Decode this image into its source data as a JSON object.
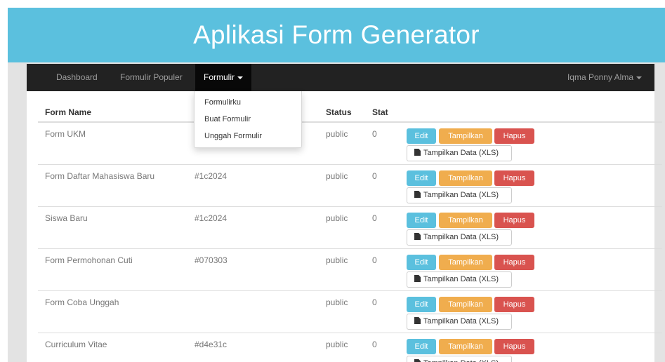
{
  "header": {
    "title": "Aplikasi Form Generator"
  },
  "navbar": {
    "items": [
      {
        "label": "Dashboard"
      },
      {
        "label": "Formulir Populer"
      },
      {
        "label": "Formulir"
      }
    ],
    "user": "Iqma Ponny Alma"
  },
  "dropdown": {
    "items": [
      {
        "label": "Formulirku"
      },
      {
        "label": "Buat Formulir"
      },
      {
        "label": "Unggah Formulir"
      }
    ]
  },
  "table": {
    "headers": {
      "name": "Form Name",
      "status": "Status",
      "stat": "Stat"
    },
    "rows": [
      {
        "name": "Form UKM",
        "color": "",
        "status": "public",
        "stat": "0"
      },
      {
        "name": "Form Daftar Mahasiswa Baru",
        "color": "#1c2024",
        "status": "public",
        "stat": "0"
      },
      {
        "name": "Siswa Baru",
        "color": "#1c2024",
        "status": "public",
        "stat": "0"
      },
      {
        "name": "Form Permohonan Cuti",
        "color": "#070303",
        "status": "public",
        "stat": "0"
      },
      {
        "name": "Form Coba Unggah",
        "color": "",
        "status": "public",
        "stat": "0"
      },
      {
        "name": "Curriculum Vitae",
        "color": "#d4e31c",
        "status": "public",
        "stat": "0"
      }
    ],
    "actions": {
      "edit": "Edit",
      "show": "Tampilkan",
      "delete": "Hapus",
      "xls": "Tampilkan Data (XLS)"
    }
  },
  "colors": {
    "header_bg": "#5bc0de",
    "navbar_bg": "#222222",
    "btn_info": "#5bc0de",
    "btn_warning": "#f0ad4e",
    "btn_danger": "#d9534f"
  }
}
